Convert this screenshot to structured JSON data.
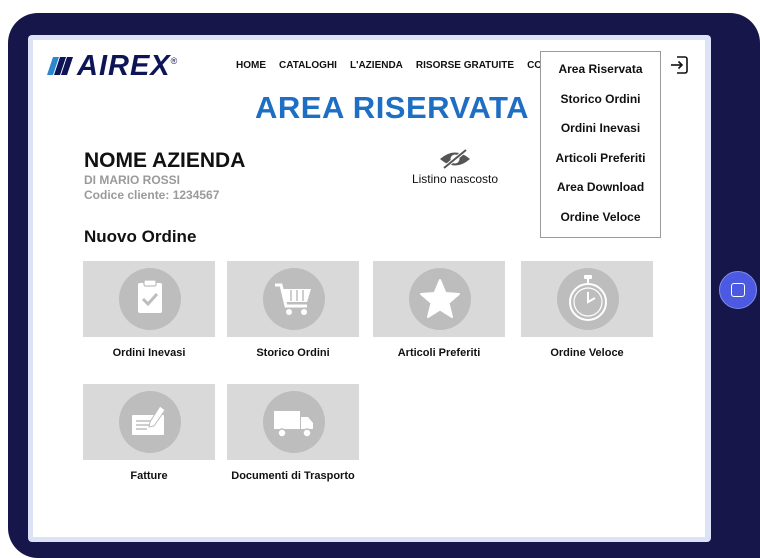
{
  "brand": {
    "logo_text": "AIREX",
    "registered": "®"
  },
  "nav": {
    "items": [
      "HOME",
      "CATALOGHI",
      "L'AZIENDA",
      "RISORSE GRATUITE",
      "CONT"
    ]
  },
  "page": {
    "title": "AREA RISERVATA"
  },
  "company": {
    "name": "NOME AZIENDA",
    "owner": "DI MARIO ROSSI",
    "client_code": "Codice cliente: 1234567"
  },
  "price_list": {
    "label": "Listino nascosto",
    "icon": "eye-slash-icon"
  },
  "section": {
    "title": "Nuovo Ordine"
  },
  "tiles": [
    {
      "label": "Ordini Inevasi",
      "icon": "clipboard-check-icon"
    },
    {
      "label": "Storico Ordini",
      "icon": "shopping-cart-icon"
    },
    {
      "label": "Articoli Preferiti",
      "icon": "star-icon"
    },
    {
      "label": "Ordine Veloce",
      "icon": "stopwatch-icon"
    },
    {
      "label": "Fatture",
      "icon": "invoice-pen-icon"
    },
    {
      "label": "Documenti di Trasporto",
      "icon": "truck-icon"
    }
  ],
  "dropdown": {
    "items": [
      "Area Riservata",
      "Storico Ordini",
      "Ordini Inevasi",
      "Articoli Preferiti",
      "Area Download",
      "Ordine Veloce"
    ]
  },
  "colors": {
    "tablet_frame": "#16164a",
    "title_blue": "#1e6fc4",
    "logo_navy": "#0d1557",
    "tile_bg": "#d9d9d9",
    "icon_circle": "#bdbdbd",
    "home_button": "#4b5ae0"
  }
}
